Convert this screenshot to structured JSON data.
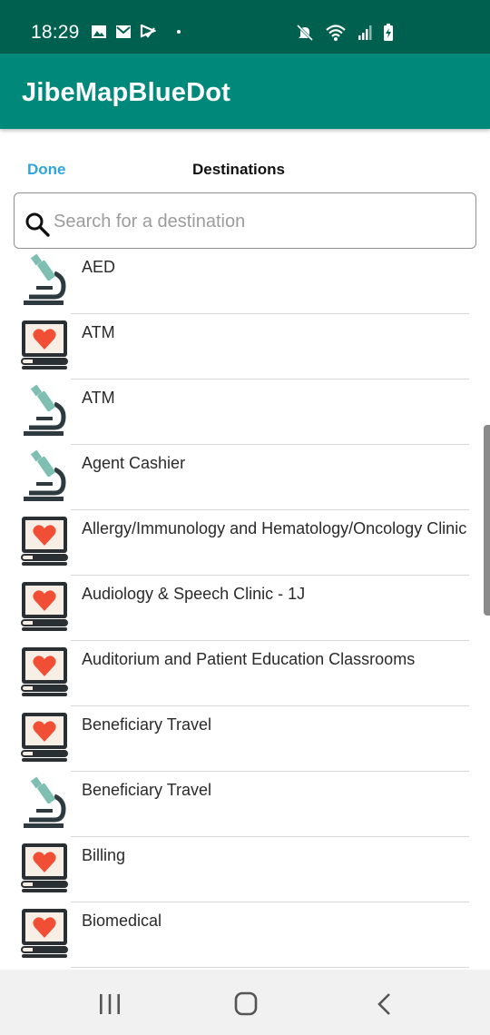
{
  "status_bar": {
    "time": "18:29",
    "left_icons": [
      "image-icon",
      "mail-icon",
      "flag-icon"
    ],
    "right_icons": [
      "mute-icon",
      "wifi-icon",
      "signal-icon",
      "battery-charging-icon"
    ]
  },
  "app_bar": {
    "title": "JibeMapBlueDot"
  },
  "header": {
    "done_label": "Done",
    "title": "Destinations"
  },
  "search": {
    "placeholder": "Search for a destination",
    "value": ""
  },
  "destinations": [
    {
      "label": "AED",
      "icon": "microscope-icon"
    },
    {
      "label": "ATM",
      "icon": "heart-monitor-icon"
    },
    {
      "label": "ATM",
      "icon": "microscope-icon"
    },
    {
      "label": "Agent Cashier",
      "icon": "microscope-icon"
    },
    {
      "label": "Allergy/Immunology and Hematology/Oncology Clinic",
      "icon": "heart-monitor-icon"
    },
    {
      "label": "Audiology & Speech Clinic - 1J",
      "icon": "heart-monitor-icon"
    },
    {
      "label": "Auditorium and Patient Education Classrooms",
      "icon": "heart-monitor-icon"
    },
    {
      "label": "Beneficiary Travel",
      "icon": "heart-monitor-icon"
    },
    {
      "label": "Beneficiary Travel",
      "icon": "microscope-icon"
    },
    {
      "label": "Billing",
      "icon": "heart-monitor-icon"
    },
    {
      "label": "Biomedical",
      "icon": "heart-monitor-icon"
    }
  ],
  "nav_bar": {
    "buttons": [
      "recent-apps-icon",
      "home-icon",
      "back-icon"
    ]
  },
  "colors": {
    "status_bar": "#00604f",
    "app_bar": "#00897b",
    "accent": "#2ea6e0",
    "heart": "#f04e35",
    "microscope_body": "#2f3a40",
    "microscope_lens": "#7fbfb2"
  }
}
